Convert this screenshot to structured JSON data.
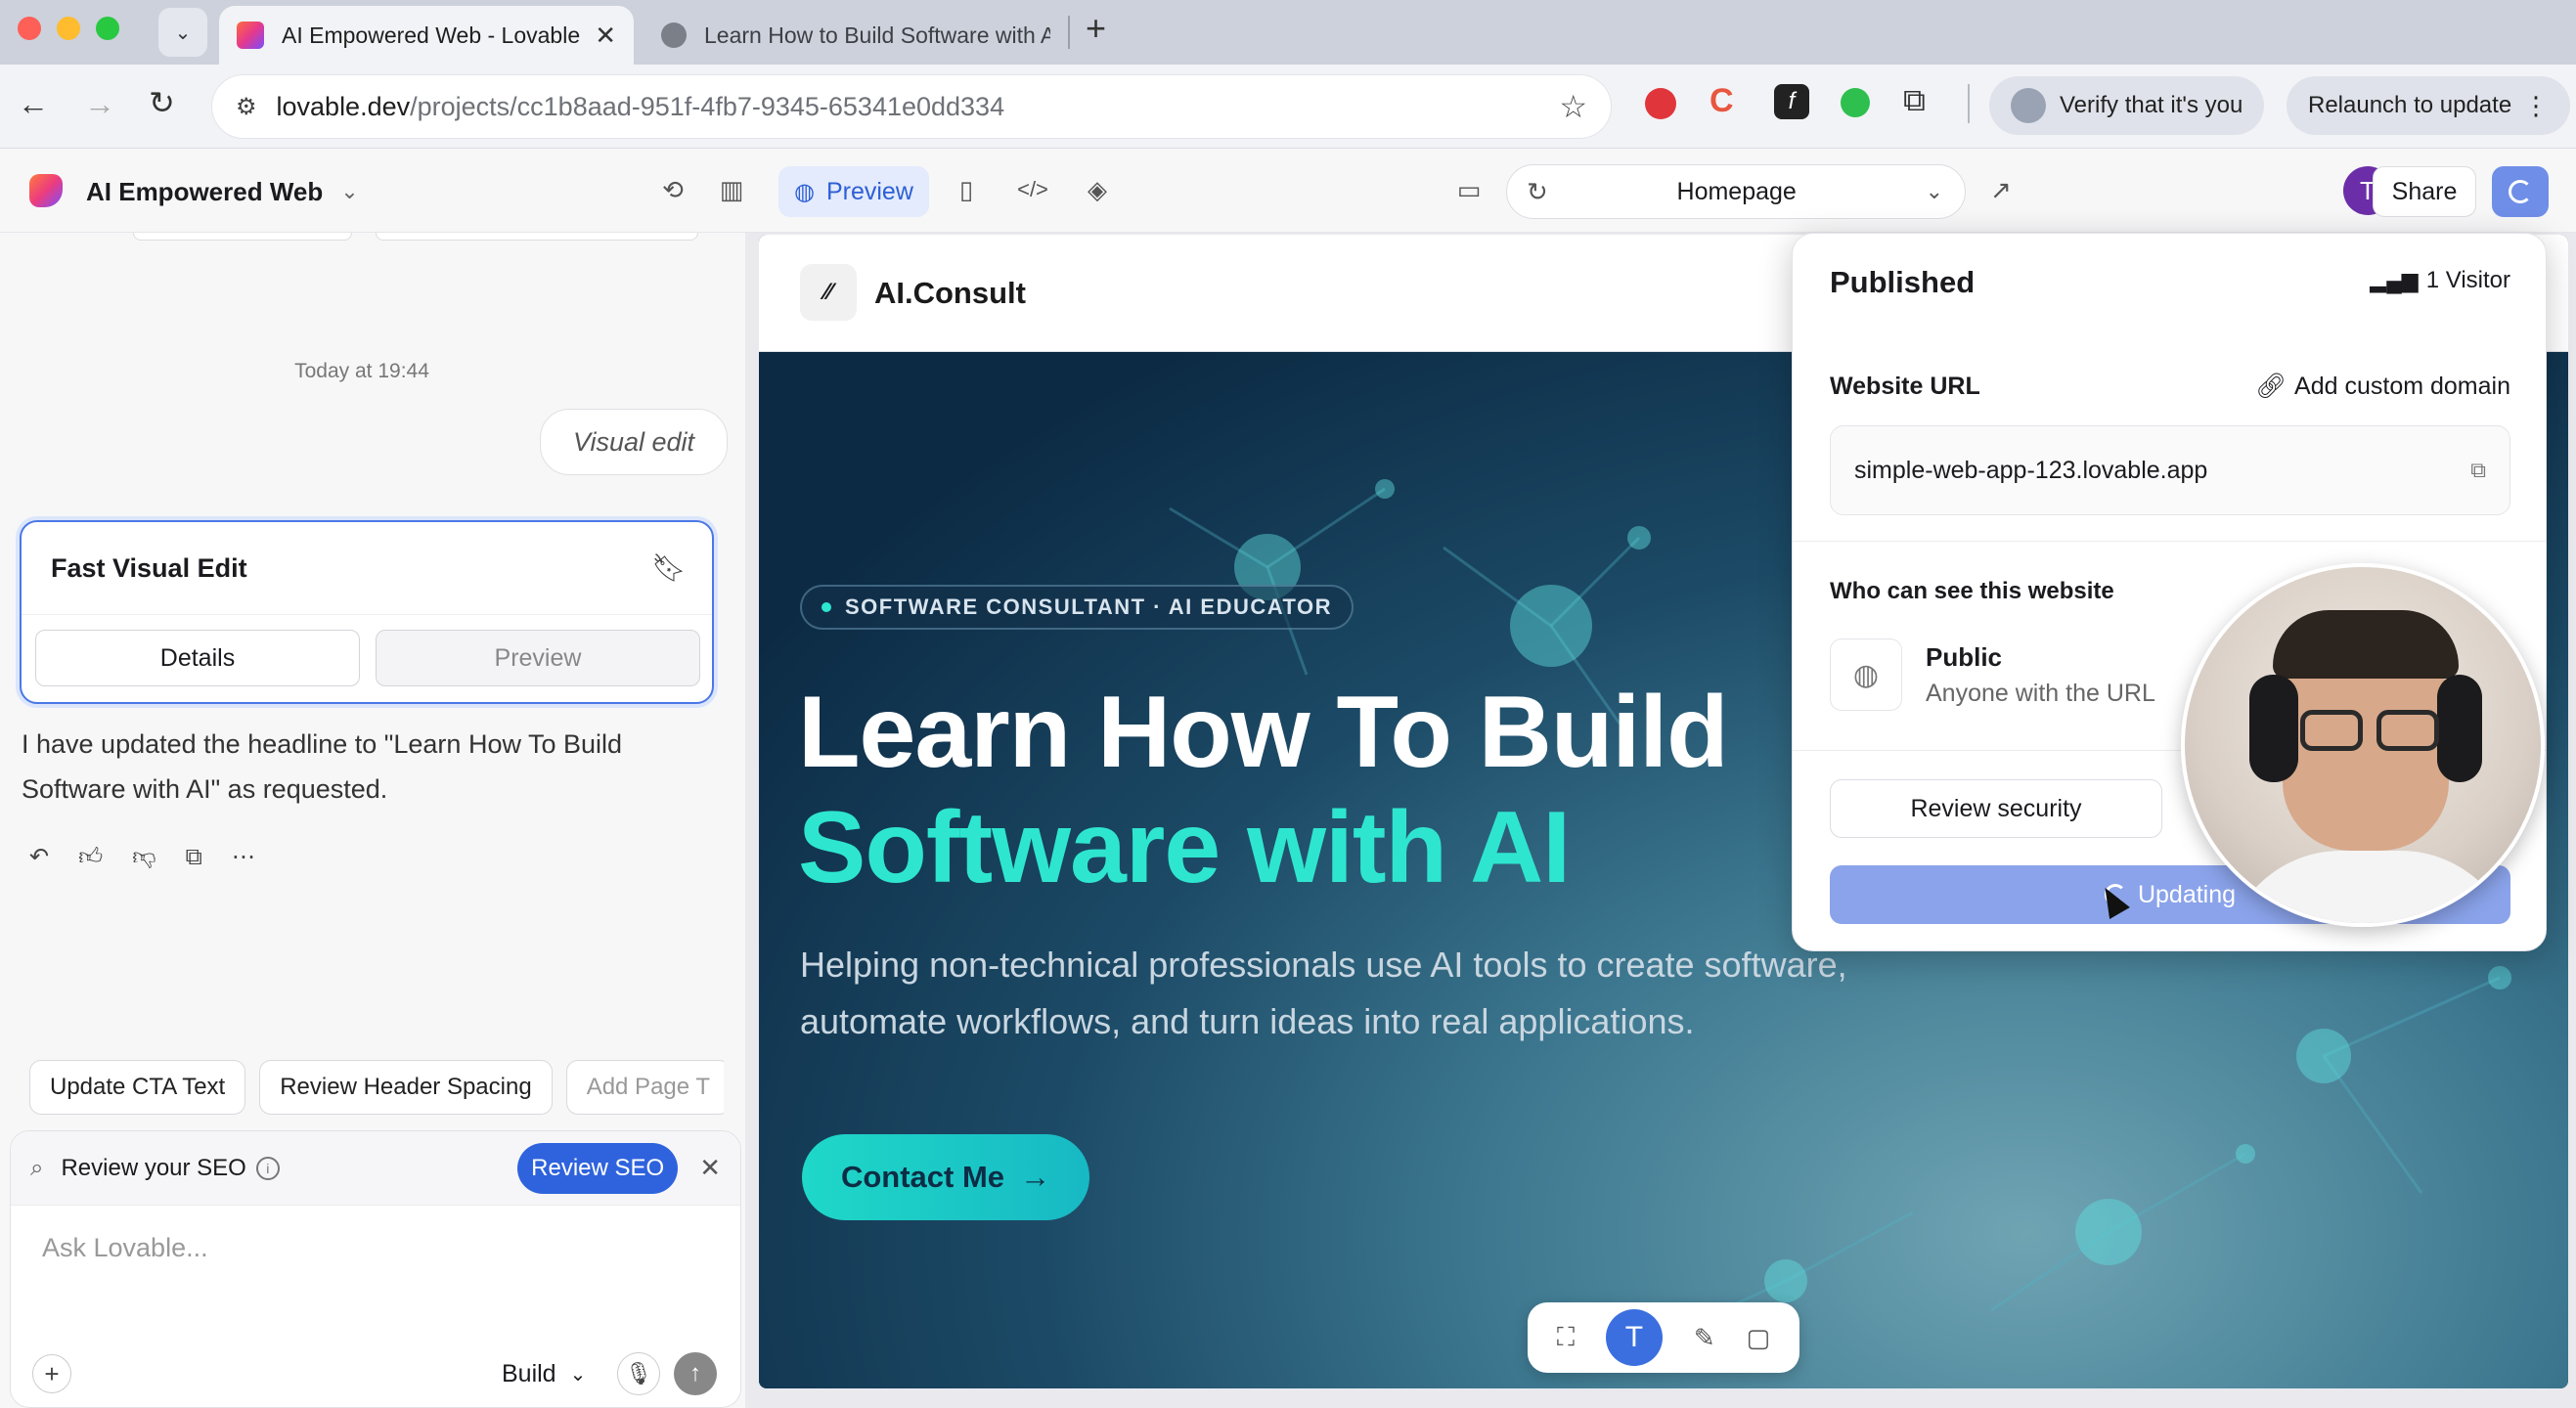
{
  "browser": {
    "tabs": [
      {
        "title": "AI Empowered Web - Lovable",
        "active": true
      },
      {
        "title": "Learn How to Build Software with AI",
        "active": false
      }
    ],
    "url_host": "lovable.dev",
    "url_path": "/projects/cc1b8aad-951f-4fb7-9345-65341e0dd334",
    "verify_label": "Verify that it's you",
    "relaunch_label": "Relaunch to update"
  },
  "app": {
    "project_name": "AI Empowered Web",
    "preview_tab": "Preview",
    "page_select": "Homepage",
    "avatar_initial": "T",
    "share_label": "Share"
  },
  "chat": {
    "timestamp": "Today at 19:44",
    "user_message": "Visual edit",
    "card_title": "Fast Visual Edit",
    "card_tab_details": "Details",
    "card_tab_preview": "Preview",
    "assistant_message": "I have updated the headline to \"Learn How To Build Software with AI\" as requested.",
    "suggestions": [
      "Update CTA Text",
      "Review Header Spacing",
      "Add Page T"
    ],
    "seo_prompt": "Review your SEO",
    "seo_button": "Review SEO",
    "input_placeholder": "Ask Lovable...",
    "mode": "Build"
  },
  "site": {
    "brand": "AI.Consult",
    "badge": "SOFTWARE CONSULTANT · AI EDUCATOR",
    "headline_line1": "Learn How To Build",
    "headline_line2": "Software with AI",
    "subtext_line1": "Helping non-technical professionals use AI tools to create software,",
    "subtext_line2": "automate workflows, and turn ideas into real applications.",
    "cta": "Contact Me"
  },
  "publish": {
    "title": "Published",
    "visitors": "1 Visitor",
    "website_url_label": "Website URL",
    "custom_domain": "Add custom domain",
    "url": "simple-web-app-123.lovable.app",
    "visibility_label": "Who can see this website",
    "visibility_value": "Public",
    "visibility_desc": "Anyone with the URL",
    "review_security": "Review security",
    "updating": "Updating"
  },
  "colors": {
    "accent_blue": "#3b6fe0",
    "teal": "#2ee6d0",
    "updating_btn": "#8aa3ea"
  }
}
